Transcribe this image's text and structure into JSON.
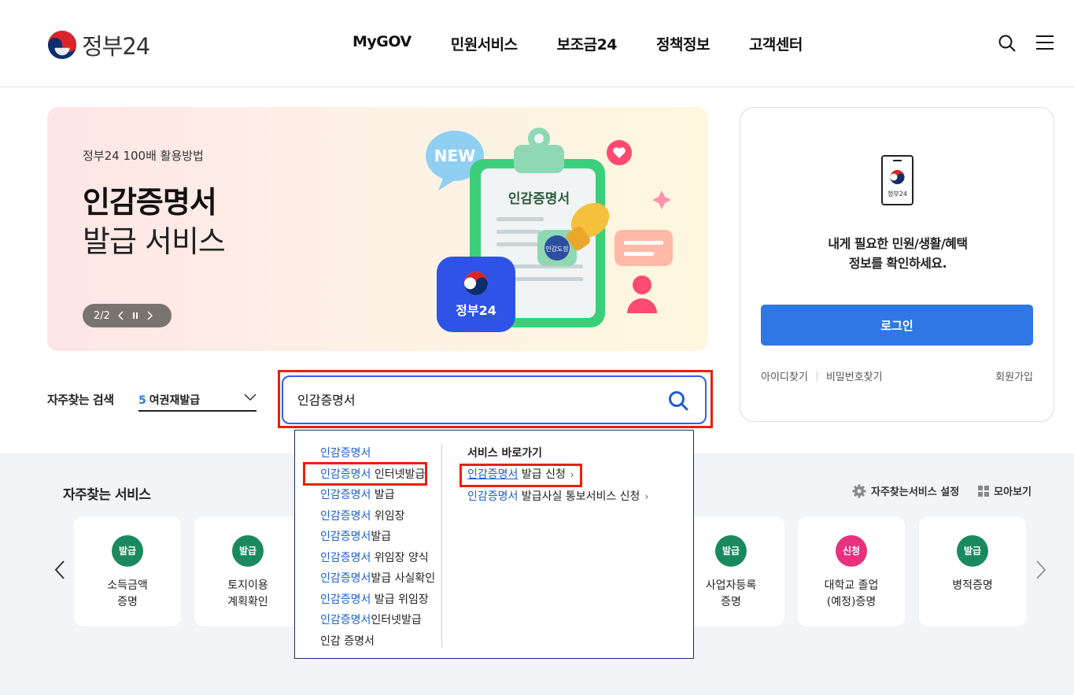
{
  "header": {
    "logo_text": "정부24",
    "nav": [
      "MyGOV",
      "민원서비스",
      "보조금24",
      "정책정보",
      "고객센터"
    ]
  },
  "hero": {
    "subtitle": "정부24 100배 활용방법",
    "title": "인감증명서",
    "title2": "발급 서비스",
    "pager": "2/2",
    "art_new_label": "NEW",
    "art_doc_label": "인감증명서",
    "art_stamp_label": "인감도장",
    "art_app_label": "정부24"
  },
  "login": {
    "phone_label": "정부24",
    "message_line1": "내게 필요한 민원/생활/혜택",
    "message_line2": "정보를 확인하세요.",
    "button": "로그인",
    "find_id": "아이디찾기",
    "find_pw": "비밀번호찾기",
    "join": "회원가입"
  },
  "search": {
    "freq_label": "자주찾는 검색",
    "rolling_num": "5",
    "rolling_text": "여권재발급",
    "value": "인감증명서"
  },
  "autocomplete": {
    "suggestions": [
      {
        "hl": "인감증명서",
        "rest": ""
      },
      {
        "hl": "인감증명서",
        "rest": " 인터넷발급"
      },
      {
        "hl": "인감증명서",
        "rest": " 발급"
      },
      {
        "hl": "인감증명서",
        "rest": " 위임장"
      },
      {
        "hl": "인감증명서",
        "rest": "발급"
      },
      {
        "hl": "인감증명서",
        "rest": " 위임장 양식"
      },
      {
        "hl": "인감증명서",
        "rest": "발급 사실확인"
      },
      {
        "hl": "인감증명서",
        "rest": " 발급 위임장"
      },
      {
        "hl": "인감증명서",
        "rest": "인터넷발급"
      },
      {
        "hl": "",
        "rest": "인감 증명서"
      }
    ],
    "shortcut_title": "서비스 바로가기",
    "shortcuts": [
      {
        "hl": "인감증명서",
        "rest": " 발급 신청"
      },
      {
        "hl": "인감증명서",
        "rest": " 발급사실 통보서비스 신청"
      }
    ]
  },
  "services": {
    "title": "자주찾는 서비스",
    "settings": "자주찾는서비스 설정",
    "view_all": "모아보기",
    "cards": [
      {
        "badge": "발급",
        "name": "소득금액\n증명",
        "color": "#1a8a5e"
      },
      {
        "badge": "발급",
        "name": "토지이용\n계획확인",
        "color": "#1a8a5e"
      },
      {
        "badge": "발급",
        "name": "사업자등록\n증명",
        "color": "#1a8a5e"
      },
      {
        "badge": "신청",
        "name": "대학교 졸업\n(예정)증명",
        "color": "#e8317f"
      },
      {
        "badge": "발급",
        "name": "병적증명",
        "color": "#1a8a5e"
      }
    ]
  },
  "colors": {
    "accent": "#2e77e5",
    "highlight_box": "#e8200c",
    "issue_badge": "#1a8a5e",
    "apply_badge": "#e8317f"
  }
}
